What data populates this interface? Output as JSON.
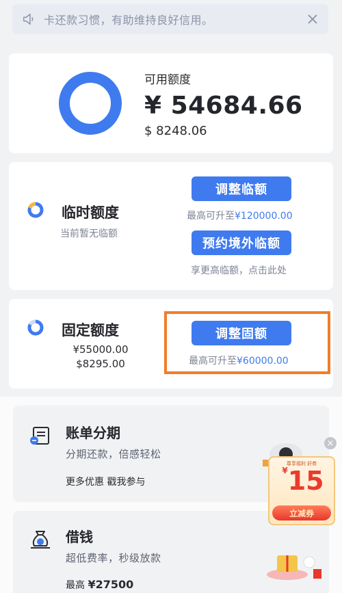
{
  "notice": {
    "text": "卡还款习惯，有助维持良好信用。"
  },
  "available": {
    "label": "可用额度",
    "amount": "¥ 54684.66",
    "sub": "$ 8248.06",
    "ring_color": "#3f7bef"
  },
  "temp_limit": {
    "title": "临时额度",
    "subtitle": "当前暂无临额",
    "adjust_button": "调整临额",
    "adjust_hint_prefix": "最高可升至",
    "adjust_hint_value": "¥120000.00",
    "reserve_button": "预约境外临额",
    "reserve_hint": "享更高临额，点击此处"
  },
  "fixed_limit": {
    "title": "固定额度",
    "cny": "¥55000.00",
    "usd": "$8295.00",
    "adjust_button": "调整固额",
    "hint_prefix": "最高可升至",
    "hint_value": "¥60000.00"
  },
  "installment": {
    "title": "账单分期",
    "desc": "分期还款，倍感轻松",
    "extra": "更多优惠 戳我参与"
  },
  "loan": {
    "title": "借钱",
    "desc": "超低费率，秒级放款",
    "extra_prefix": "最高",
    "extra_value": "¥27500"
  },
  "promo": {
    "top_text": "尊享福利 好券",
    "currency": "¥",
    "number": "15",
    "button": "立减券"
  },
  "colors": {
    "accent": "#3f7bef",
    "highlight": "#f27c2a",
    "promo_red": "#ea3b2d"
  }
}
